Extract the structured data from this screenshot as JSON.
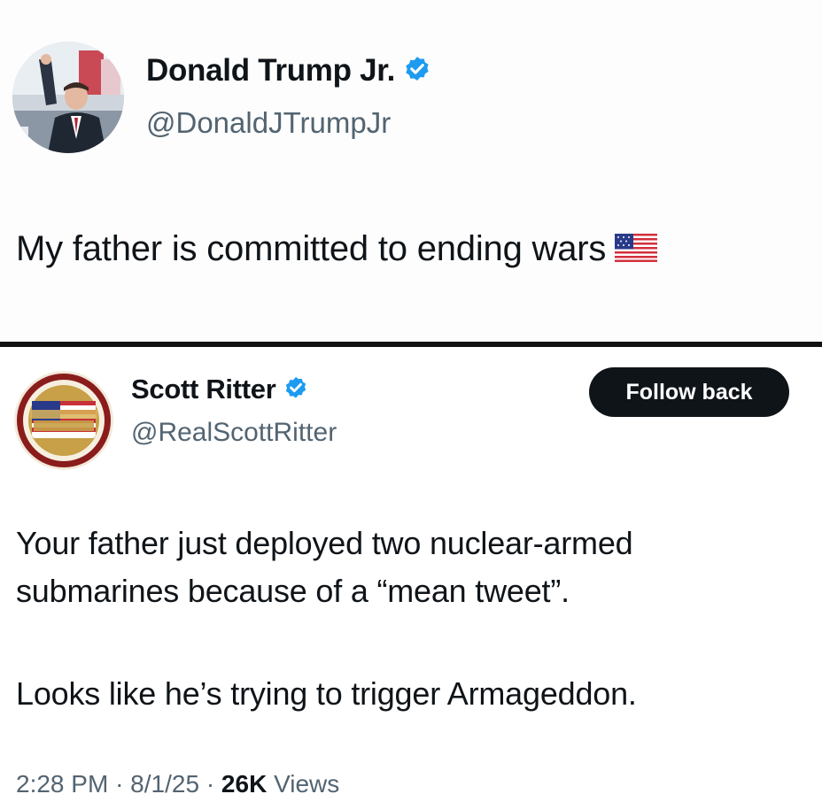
{
  "top_tweet": {
    "author_name": "Donald Trump Jr.",
    "handle": "@DonaldJTrumpJr",
    "text": "My father is committed to ending wars",
    "emoji": "us-flag"
  },
  "bottom_tweet": {
    "author_name": "Scott Ritter",
    "handle": "@RealScottRitter",
    "follow_label": "Follow back",
    "paragraph_1": "Your father just deployed two nuclear-armed\nsubmarines because of a “mean tweet”.",
    "paragraph_2": "Looks like he’s trying to trigger Armageddon.",
    "time": "2:28 PM",
    "date": "8/1/25",
    "views_count": "26K",
    "views_label": "Views",
    "separator": "·"
  },
  "colors": {
    "verified_blue": "#1d9bf0",
    "text_primary": "#0f1419",
    "text_secondary": "#536471",
    "button_bg": "#0f1419"
  }
}
